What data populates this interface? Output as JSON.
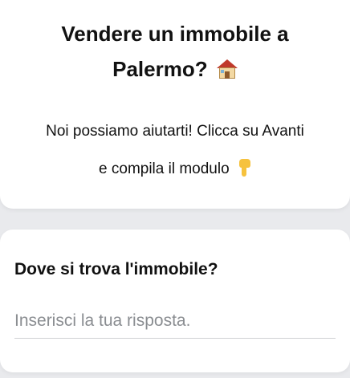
{
  "intro": {
    "title_line1": "Vendere un immobile a",
    "title_line2": "Palermo?",
    "title_icon": "house-emoji-icon",
    "text_line1": "Noi possiamo aiutarti! Clicca su Avanti",
    "text_line2": "e compila il modulo",
    "text_icon": "pointing-down-emoji-icon"
  },
  "question": {
    "label": "Dove si trova l'immobile?",
    "input_value": "",
    "input_placeholder": "Inserisci la tua risposta."
  },
  "colors": {
    "background": "#e9eaed",
    "card": "#ffffff",
    "text": "#111111",
    "placeholder": "#8a8d91",
    "underline": "#cfd1d4"
  }
}
